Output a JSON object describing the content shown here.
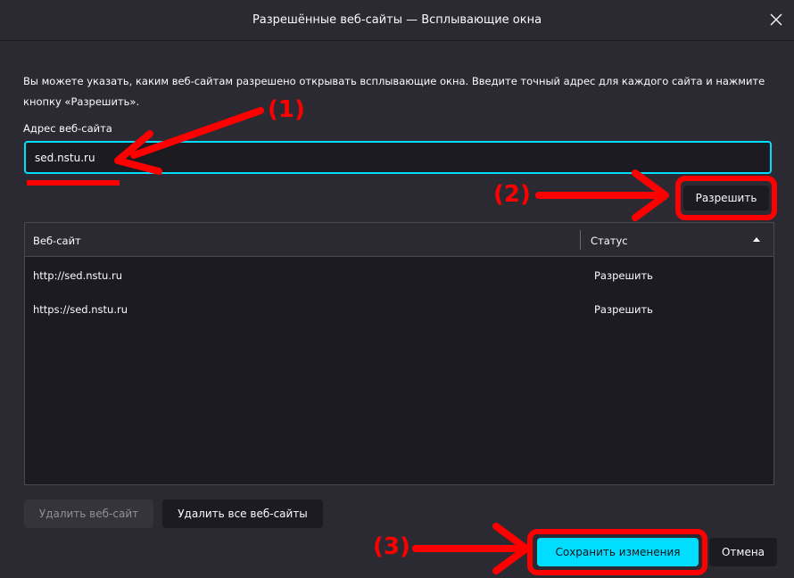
{
  "dialog": {
    "title": "Разрешённые веб-сайты — Всплывающие окна",
    "close_glyph": "✕",
    "description": "Вы можете указать, каким веб-сайтам разрешено открывать всплывающие окна. Введите точный адрес для каждого сайта и нажмите кнопку «Разрешить»."
  },
  "address": {
    "label": "Адрес веб-сайта",
    "value": "sed.nstu.ru"
  },
  "allow_button": "Разрешить",
  "table": {
    "columns": {
      "site": "Веб-сайт",
      "status": "Статус"
    },
    "sort_icon": "sort-ascending-icon",
    "rows": [
      {
        "site": "http://sed.nstu.ru",
        "status": "Разрешить"
      },
      {
        "site": "https://sed.nstu.ru",
        "status": "Разрешить"
      }
    ]
  },
  "buttons": {
    "remove_site": "Удалить веб-сайт",
    "remove_all": "Удалить все веб-сайты",
    "save": "Сохранить изменения",
    "cancel": "Отмена"
  },
  "annotations": {
    "step1": "(1)",
    "step2": "(2)",
    "step3": "(3)",
    "color": "#ff0000"
  },
  "colors": {
    "background": "#2b2a33",
    "field": "#1c1b22",
    "accent": "#00ddff",
    "text": "#fbfbfe"
  }
}
